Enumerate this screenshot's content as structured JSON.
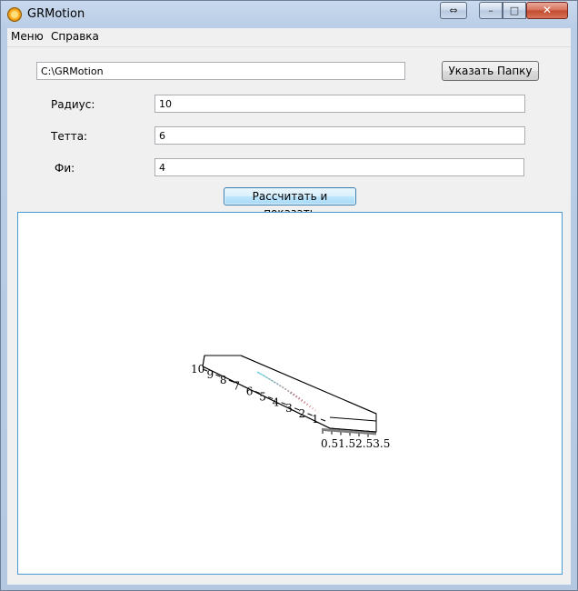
{
  "window": {
    "title": "GRMotion",
    "controls": {
      "extra_glyph": "⇔",
      "minimize_glyph": "–",
      "maximize_glyph": "□",
      "close_glyph": "✕"
    }
  },
  "menu": {
    "items": [
      "Меню",
      "Справка"
    ]
  },
  "folder": {
    "path": "C:\\GRMotion",
    "browse_label": "Указать Папку"
  },
  "params": [
    {
      "label": "Радиус:",
      "value": "10"
    },
    {
      "label": "Тетта:",
      "value": "6"
    },
    {
      "label": "Фи:",
      "value": "4"
    }
  ],
  "compute_label": "Рассчитать и показать",
  "plot": {
    "y_ticks": [
      "10",
      "9",
      "8",
      "7",
      "6",
      "5",
      "4",
      "3",
      "2",
      "1"
    ],
    "x_ticks_text": "0.51.52.53.5",
    "colors": {
      "curve_start": "#6fd3df",
      "curve_end": "#d9333c",
      "axes": "#000000"
    }
  }
}
